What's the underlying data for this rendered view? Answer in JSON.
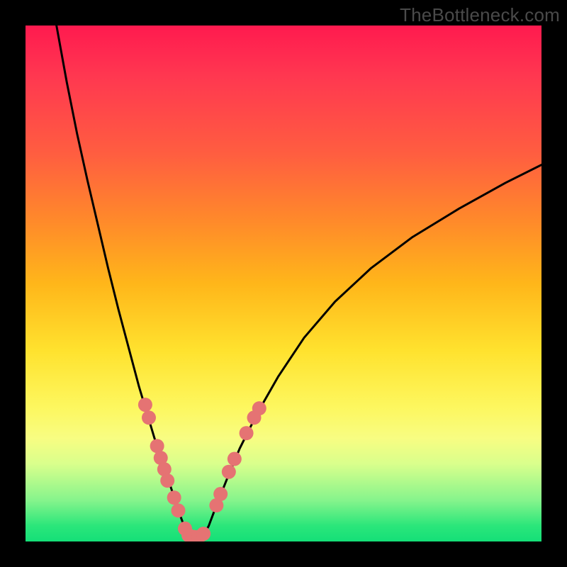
{
  "watermark": "TheBottleneck.com",
  "chart_data": {
    "type": "line",
    "title": "",
    "xlabel": "",
    "ylabel": "",
    "xlim": [
      0,
      100
    ],
    "ylim": [
      0,
      100
    ],
    "grid": false,
    "legend": false,
    "background": "gradient red→yellow→green (top→bottom)",
    "series": [
      {
        "name": "left-curve",
        "x": [
          6,
          8,
          10,
          12,
          14,
          16,
          18,
          20,
          22,
          23.5,
          25,
          26.5,
          28,
          29,
          30,
          30.8,
          31.5
        ],
        "y": [
          100,
          89,
          79,
          70,
          61.5,
          53,
          45,
          37.5,
          30,
          25,
          20,
          15.5,
          11,
          8,
          5,
          2.8,
          1.2
        ]
      },
      {
        "name": "right-curve",
        "x": [
          34.5,
          35.5,
          37,
          39,
          41.5,
          45,
          49,
          54,
          60,
          67,
          75,
          84,
          93,
          100
        ],
        "y": [
          1.2,
          3,
          7,
          12,
          18,
          25,
          32,
          39.5,
          46.5,
          53,
          59,
          64.5,
          69.5,
          73
        ]
      },
      {
        "name": "floor-link",
        "x": [
          31.5,
          34.5
        ],
        "y": [
          1.2,
          1.2
        ]
      }
    ],
    "scatter": [
      {
        "name": "left-dots",
        "color": "#e57373",
        "points": [
          {
            "x": 23.2,
            "y": 26.5
          },
          {
            "x": 23.9,
            "y": 24.0
          },
          {
            "x": 25.5,
            "y": 18.5
          },
          {
            "x": 26.2,
            "y": 16.2
          },
          {
            "x": 26.9,
            "y": 14.0
          },
          {
            "x": 27.5,
            "y": 11.8
          },
          {
            "x": 28.8,
            "y": 8.5
          },
          {
            "x": 29.6,
            "y": 6.0
          },
          {
            "x": 30.9,
            "y": 2.5
          },
          {
            "x": 31.6,
            "y": 1.2
          },
          {
            "x": 32.6,
            "y": 0.9
          },
          {
            "x": 33.6,
            "y": 0.9
          },
          {
            "x": 34.5,
            "y": 1.5
          }
        ]
      },
      {
        "name": "right-dots",
        "color": "#e57373",
        "points": [
          {
            "x": 37.0,
            "y": 7.0
          },
          {
            "x": 37.8,
            "y": 9.2
          },
          {
            "x": 39.4,
            "y": 13.5
          },
          {
            "x": 40.5,
            "y": 16.0
          },
          {
            "x": 42.8,
            "y": 21.0
          },
          {
            "x": 44.3,
            "y": 24.0
          },
          {
            "x": 45.3,
            "y": 25.8
          }
        ]
      }
    ]
  }
}
